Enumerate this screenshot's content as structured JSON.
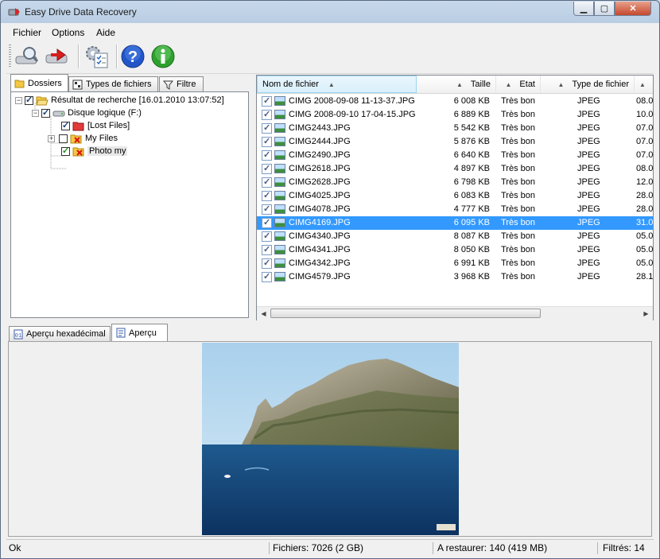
{
  "window": {
    "title": "Easy Drive Data Recovery"
  },
  "menu": [
    "Fichier",
    "Options",
    "Aide"
  ],
  "toolbar": {
    "buttons": [
      {
        "name": "scan-drive",
        "icon": "drive-search-icon"
      },
      {
        "name": "restore",
        "icon": "drive-restore-icon"
      },
      {
        "name": "settings",
        "icon": "settings-checklist-icon"
      },
      {
        "name": "help",
        "icon": "help-icon"
      },
      {
        "name": "info",
        "icon": "info-icon"
      }
    ]
  },
  "left_tabs": [
    "Dossiers",
    "Types de fichiers",
    "Filtre"
  ],
  "tree": [
    {
      "label": "Résultat de recherche [16.01.2010 13:07:52]",
      "checked": true
    },
    {
      "label": "Disque logique (F:)",
      "checked": true
    },
    {
      "label": "[Lost Files]",
      "checked": true
    },
    {
      "label": "My Files",
      "checked": false
    },
    {
      "label": "Photo my",
      "checked": true
    }
  ],
  "columns": [
    "Nom de fichier",
    "Taille",
    "Etat",
    "Type de fichier"
  ],
  "files": [
    {
      "name": "CIMG 2008-09-08 11-13-37.JPG",
      "size": "6 008 KB",
      "state": "Très bon",
      "type": "JPEG",
      "date": "08.0"
    },
    {
      "name": "CIMG 2008-09-10 17-04-15.JPG",
      "size": "6 889 KB",
      "state": "Très bon",
      "type": "JPEG",
      "date": "10.0"
    },
    {
      "name": "CIMG2443.JPG",
      "size": "5 542 KB",
      "state": "Très bon",
      "type": "JPEG",
      "date": "07.0"
    },
    {
      "name": "CIMG2444.JPG",
      "size": "5 876 KB",
      "state": "Très bon",
      "type": "JPEG",
      "date": "07.0"
    },
    {
      "name": "CIMG2490.JPG",
      "size": "6 640 KB",
      "state": "Très bon",
      "type": "JPEG",
      "date": "07.0"
    },
    {
      "name": "CIMG2618.JPG",
      "size": "4 897 KB",
      "state": "Très bon",
      "type": "JPEG",
      "date": "08.0"
    },
    {
      "name": "CIMG2628.JPG",
      "size": "6 798 KB",
      "state": "Très bon",
      "type": "JPEG",
      "date": "12.0"
    },
    {
      "name": "CIMG4025.JPG",
      "size": "6 083 KB",
      "state": "Très bon",
      "type": "JPEG",
      "date": "28.0"
    },
    {
      "name": "CIMG4078.JPG",
      "size": "4 777 KB",
      "state": "Très bon",
      "type": "JPEG",
      "date": "28.0"
    },
    {
      "name": "CIMG4169.JPG",
      "size": "6 095 KB",
      "state": "Très bon",
      "type": "JPEG",
      "date": "31.0"
    },
    {
      "name": "CIMG4340.JPG",
      "size": "8 087 KB",
      "state": "Très bon",
      "type": "JPEG",
      "date": "05.0"
    },
    {
      "name": "CIMG4341.JPG",
      "size": "8 050 KB",
      "state": "Très bon",
      "type": "JPEG",
      "date": "05.0"
    },
    {
      "name": "CIMG4342.JPG",
      "size": "6 991 KB",
      "state": "Très bon",
      "type": "JPEG",
      "date": "05.0"
    },
    {
      "name": "CIMG4579.JPG",
      "size": "3 968 KB",
      "state": "Très bon",
      "type": "JPEG",
      "date": "28.1"
    }
  ],
  "selected_file_index": 9,
  "bottom_tabs": [
    "Aperçu hexadécimal",
    "Aperçu"
  ],
  "status": {
    "state": "Ok",
    "files": "Fichiers: 7026 (2 GB)",
    "restore": "A restaurer: 140 (419 MB)",
    "filtered": "Filtrés: 14"
  },
  "colors": {
    "selection": "#3399ff",
    "title_gradient": "#c7d8ea"
  }
}
